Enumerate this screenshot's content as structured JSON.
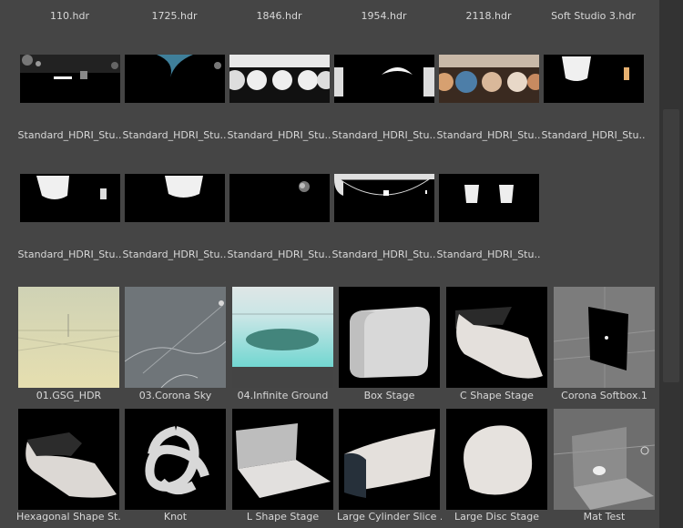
{
  "row1": {
    "labels": [
      "110.hdr",
      "1725.hdr",
      "1846.hdr",
      "1954.hdr",
      "2118.hdr",
      "Soft Studio 3.hdr"
    ],
    "thumbs": [
      "110-hdr-thumbnail",
      "1725-hdr-thumbnail",
      "1846-hdr-thumbnail",
      "1954-hdr-thumbnail",
      "2118-hdr-thumbnail",
      "soft-studio-3-thumbnail"
    ]
  },
  "row2": {
    "labels": [
      "Standard_HDRI_Stu..",
      "Standard_HDRI_Stu..",
      "Standard_HDRI_Stu..",
      "Standard_HDRI_Stu..",
      "Standard_HDRI_Stu..",
      "Standard_HDRI_Stu.."
    ]
  },
  "row3": {
    "labels": [
      "Standard_HDRI_Stu..",
      "Standard_HDRI_Stu..",
      "Standard_HDRI_Stu..",
      "Standard_HDRI_Stu..",
      "Standard_HDRI_Stu.."
    ]
  },
  "row4": {
    "labels": [
      "01.GSG_HDR",
      "03.Corona Sky",
      "04.Infinite Ground",
      "Box  Stage",
      "C Shape Stage",
      "Corona Softbox.1"
    ]
  },
  "row5": {
    "labels": [
      "Hexagonal Shape St..",
      "Knot",
      "L Shape Stage",
      "Large Cylinder Slice ..",
      "Large Disc Stage",
      "Mat Test"
    ]
  }
}
